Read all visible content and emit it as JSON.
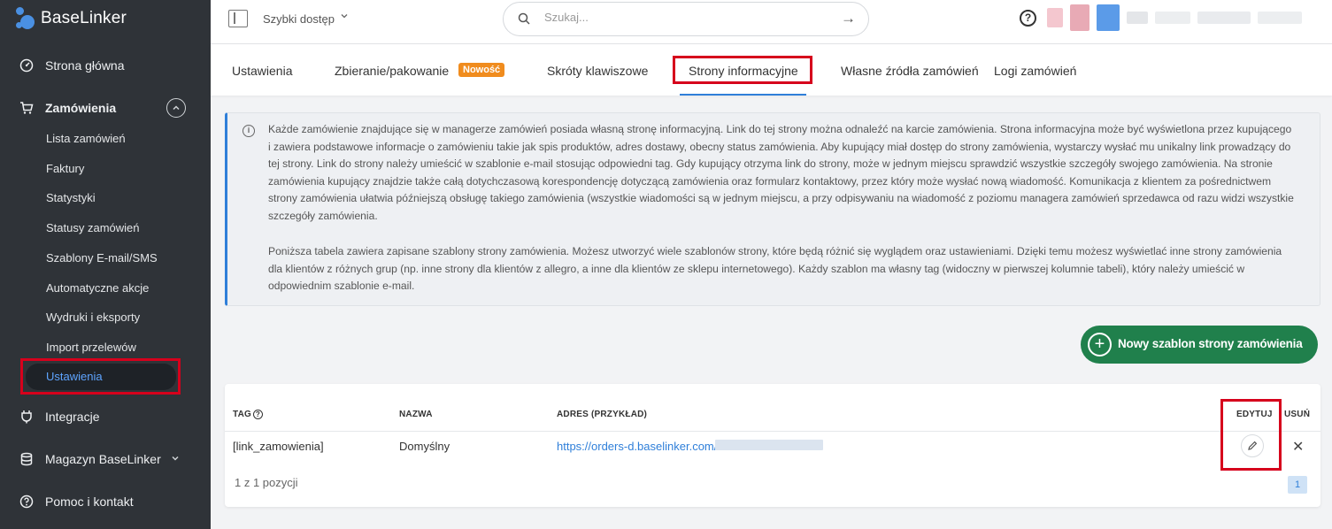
{
  "app": {
    "logo_text": "BaseLinker"
  },
  "sidebar": {
    "home": "Strona główna",
    "orders": "Zamówienia",
    "sub_items": [
      "Lista zamówień",
      "Faktury",
      "Statystyki",
      "Statusy zamówień",
      "Szablony E-mail/SMS",
      "Automatyczne akcje",
      "Wydruki i eksporty",
      "Import przelewów"
    ],
    "active_sub": "Ustawienia",
    "integrations": "Integracje",
    "warehouse": "Magazyn BaseLinker",
    "help": "Pomoc i kontakt"
  },
  "topbar": {
    "quick_access": "Szybki dostęp",
    "search_placeholder": "Szukaj..."
  },
  "tabs": {
    "items": [
      "Ustawienia",
      "Zbieranie/pakowanie",
      "Skróty klawiszowe",
      "Strony informacyjne",
      "Własne źródła zamówień",
      "Logi zamówień"
    ],
    "new_badge": "Nowość",
    "active": "Strony informacyjne"
  },
  "info": {
    "paragraph1": "Każde zamówienie znajdujące się w managerze zamówień posiada własną stronę informacyjną. Link do tej strony można odnaleźć na karcie zamówienia. Strona informacyjna może być wyświetlona przez kupującego i zawiera podstawowe informacje o zamówieniu takie jak spis produktów, adres dostawy, obecny status zamówienia. Aby kupujący miał dostęp do strony zamówienia, wystarczy wysłać mu unikalny link prowadzący do tej strony. Link do strony należy umieścić w szablonie e-mail stosując odpowiedni tag. Gdy kupujący otrzyma link do strony, może w jednym miejscu sprawdzić wszystkie szczegóły swojego zamówienia. Na stronie zamówienia kupujący znajdzie także całą dotychczasową korespondencję dotyczącą zamówienia oraz formularz kontaktowy, przez który może wysłać nową wiadomość. Komunikacja z klientem za pośrednictwem strony zamówienia ułatwia późniejszą obsługę takiego zamówienia (wszystkie wiadomości są w jednym miejscu, a przy odpisywaniu na wiadomość z poziomu managera zamówień sprzedawca od razu widzi wszystkie szczegóły zamówienia.",
    "paragraph2": "Poniższa tabela zawiera zapisane szablony strony zamówienia. Możesz utworzyć wiele szablonów strony, które będą różnić się wyglądem oraz ustawieniami. Dzięki temu możesz wyświetlać inne strony zamówienia dla klientów z różnych grup (np. inne strony dla klientów z allegro, a inne dla klientów ze sklepu internetowego). Każdy szablon ma własny tag (widoczny w pierwszej kolumnie tabeli), który należy umieścić w odpowiednim szablonie e-mail."
  },
  "new_template_button": "Nowy szablon strony zamówienia",
  "table": {
    "headers": {
      "tag": "TAG",
      "name": "NAZWA",
      "address": "ADRES (PRZYKŁAD)",
      "edit": "EDYTUJ",
      "delete": "USUŃ"
    },
    "rows": [
      {
        "tag": "[link_zamowienia]",
        "name": "Domyślny",
        "address": "https://orders-d.baselinker.com/"
      }
    ],
    "count": "1 z 1 pozycji",
    "page": "1"
  },
  "colors": {
    "sidebar_bg": "#2f3338",
    "accent": "#2f7fd9",
    "primary_button": "#20804c",
    "highlight_box": "#d6001c",
    "badge": "#f08c1e"
  }
}
